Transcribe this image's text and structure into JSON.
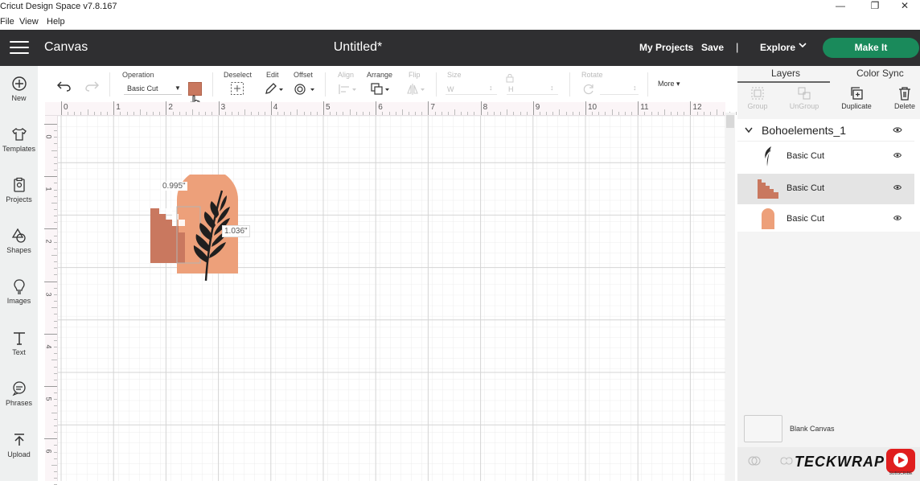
{
  "window": {
    "title": "Cricut Design Space  v7.8.167",
    "menu": [
      "File",
      "View",
      "Help"
    ]
  },
  "header": {
    "app_title": "Canvas",
    "doc_title": "Untitled*",
    "my_projects": "My Projects",
    "save": "Save",
    "separator": "|",
    "explore": "Explore",
    "make_it": "Make It"
  },
  "sidebar": {
    "items": [
      {
        "label": "New",
        "icon": "plus-circle-icon"
      },
      {
        "label": "Templates",
        "icon": "shirt-icon"
      },
      {
        "label": "Projects",
        "icon": "clipboard-icon"
      },
      {
        "label": "Shapes",
        "icon": "shapes-icon"
      },
      {
        "label": "Images",
        "icon": "lightbulb-icon"
      },
      {
        "label": "Text",
        "icon": "text-icon"
      },
      {
        "label": "Phrases",
        "icon": "speech-bubble-icon"
      },
      {
        "label": "Upload",
        "icon": "upload-icon"
      }
    ]
  },
  "toolbar": {
    "operation_label": "Operation",
    "operation_value": "Basic Cut",
    "operation_color": "#c9785f",
    "deselect": "Deselect",
    "edit": "Edit",
    "offset": "Offset",
    "align": "Align",
    "arrange": "Arrange",
    "flip": "Flip",
    "size": "Size",
    "size_w": "W",
    "size_h": "H",
    "rotate": "Rotate",
    "more": "More"
  },
  "canvas": {
    "ruler_x": [
      "0",
      "1",
      "2",
      "3",
      "4",
      "5",
      "6",
      "7",
      "8",
      "9",
      "10",
      "11",
      "12"
    ],
    "ruler_y": [
      "0",
      "1",
      "2",
      "3",
      "4",
      "5",
      "6"
    ],
    "width_readout": "0.995\"",
    "height_readout": "1.036\""
  },
  "right_panel": {
    "tabs": [
      "Layers",
      "Color Sync"
    ],
    "tools": [
      {
        "label": "Group",
        "enabled": false
      },
      {
        "label": "UnGroup",
        "enabled": false
      },
      {
        "label": "Duplicate",
        "enabled": true
      },
      {
        "label": "Delete",
        "enabled": true
      }
    ],
    "group_name": "Bohoelements_1",
    "layers": [
      {
        "name": "Basic Cut",
        "thumb": "leaf",
        "selected": false
      },
      {
        "name": "Basic Cut",
        "thumb": "stairs",
        "selected": true
      },
      {
        "name": "Basic Cut",
        "thumb": "arch",
        "selected": false
      }
    ],
    "blank_canvas": "Blank Canvas"
  },
  "colors": {
    "header_bg": "#2f2f31",
    "make_it": "#1a8a5b",
    "terracotta": "#c9785f",
    "peach": "#eda07a",
    "leaf": "#1f1f1f"
  },
  "watermark": {
    "text": "TECKWRAP",
    "badge": "SUBSCRIBE"
  }
}
